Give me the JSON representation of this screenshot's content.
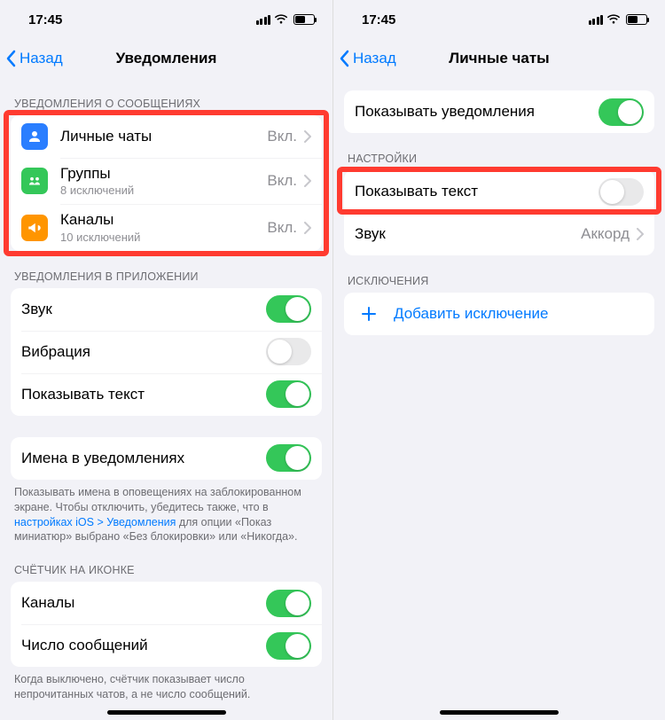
{
  "left": {
    "status_time": "17:45",
    "nav": {
      "back": "Назад",
      "title": "Уведомления"
    },
    "section1_header": "УВЕДОМЛЕНИЯ О СООБЩЕНИЯХ",
    "chats": [
      {
        "title": "Личные чаты",
        "sub": "",
        "value": "Вкл."
      },
      {
        "title": "Группы",
        "sub": "8 исключений",
        "value": "Вкл."
      },
      {
        "title": "Каналы",
        "sub": "10 исключений",
        "value": "Вкл."
      }
    ],
    "section2_header": "УВЕДОМЛЕНИЯ В ПРИЛОЖЕНИИ",
    "inapp": [
      {
        "title": "Звук",
        "on": true
      },
      {
        "title": "Вибрация",
        "on": false
      },
      {
        "title": "Показывать текст",
        "on": true
      }
    ],
    "names_row": {
      "title": "Имена в уведомлениях",
      "on": true
    },
    "names_footer_pre": "Показывать имена в оповещениях на заблокированном экране. Чтобы отключить, убедитесь также, что в ",
    "names_footer_link": "настройках iOS > Уведомления",
    "names_footer_post": " для опции «Показ миниатюр» выбрано «Без блокировки» или «Никогда».",
    "section4_header": "СЧЁТЧИК НА ИКОНКЕ",
    "badge": [
      {
        "title": "Каналы",
        "on": true
      },
      {
        "title": "Число сообщений",
        "on": true
      }
    ],
    "badge_footer": "Когда выключено, счётчик показывает число непрочитанных чатов, а не число сообщений."
  },
  "right": {
    "status_time": "17:45",
    "nav": {
      "back": "Назад",
      "title": "Личные чаты"
    },
    "show_notifications": {
      "title": "Показывать уведомления",
      "on": true
    },
    "section_settings_header": "НАСТРОЙКИ",
    "settings": [
      {
        "title": "Показывать текст",
        "on": false
      },
      {
        "title": "Звук",
        "value": "Аккорд"
      }
    ],
    "section_exceptions_header": "ИСКЛЮЧЕНИЯ",
    "add_exception": "Добавить исключение"
  }
}
